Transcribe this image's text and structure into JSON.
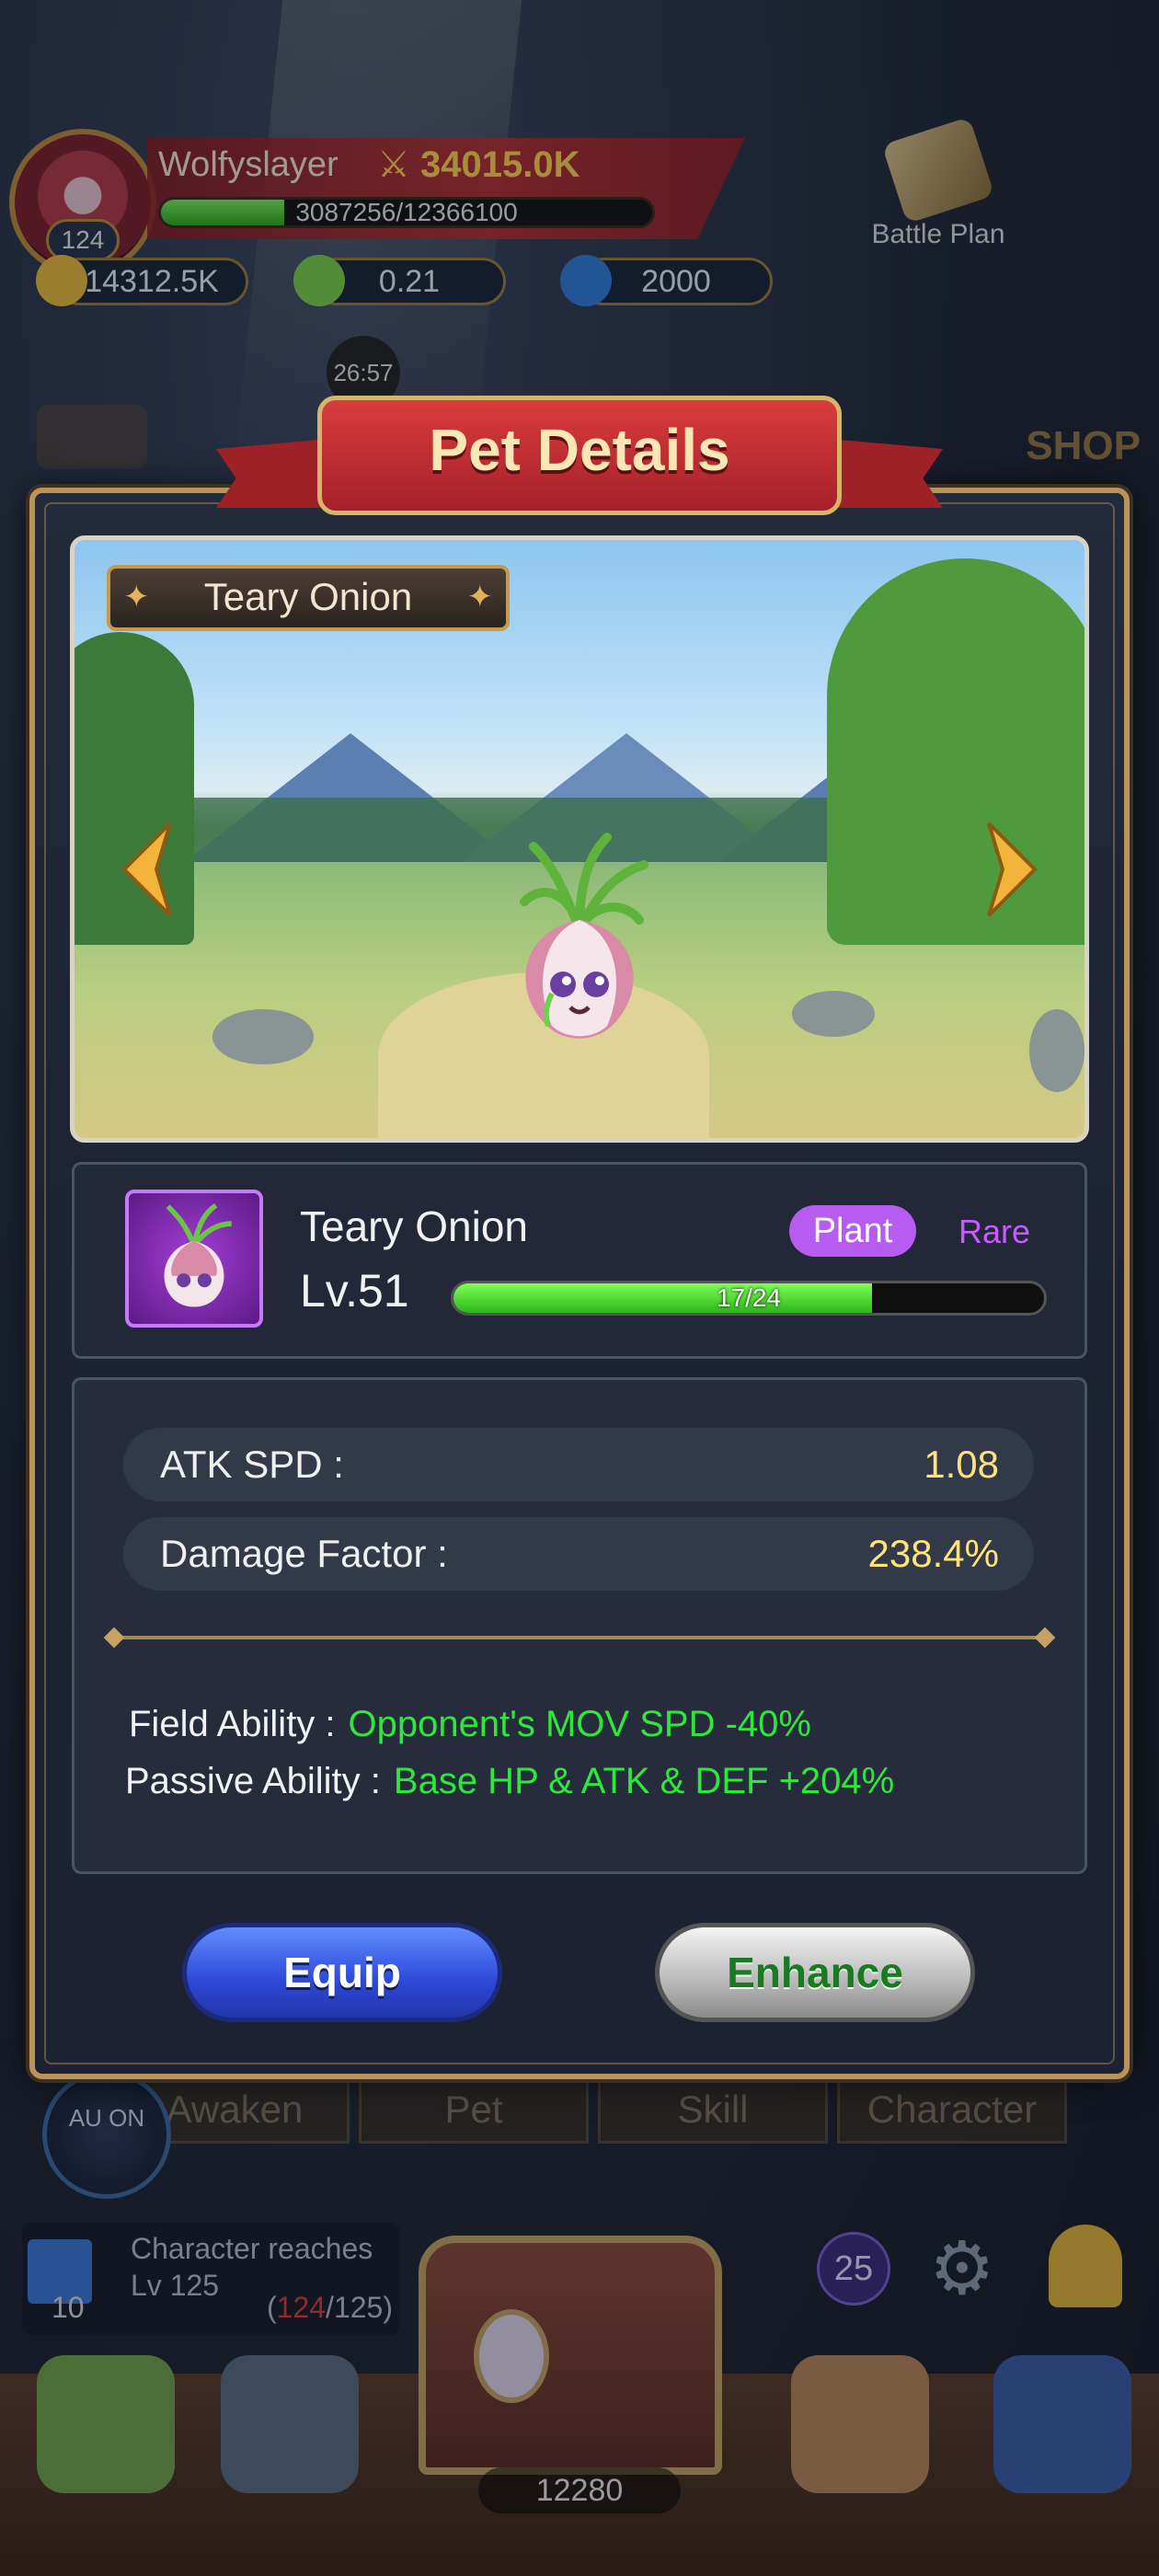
{
  "player": {
    "name": "Wolfyslayer",
    "power": "34015.0K",
    "level": "124",
    "xp_text": "3087256/12366100",
    "xp_fraction": 0.25
  },
  "currencies": [
    {
      "value": "14312.5K",
      "icon": "gold-coin-icon"
    },
    {
      "value": "0.21",
      "icon": "gem-flower-icon"
    },
    {
      "value": "2000",
      "icon": "blue-crystal-icon"
    }
  ],
  "battle_plan_label": "Battle Plan",
  "timer_text": "26:57",
  "shop_label": "SHOP",
  "modal": {
    "title": "Pet Details",
    "pet_plate_name": "Teary Onion",
    "pet": {
      "name": "Teary Onion",
      "level": "Lv.51",
      "type_tag": "Plant",
      "rarity": "Rare",
      "progress_text": "17/24",
      "progress_fraction": 0.708
    },
    "stats": [
      {
        "label": "ATK SPD :",
        "value": "1.08"
      },
      {
        "label": "Damage Factor :",
        "value": "238.4%"
      }
    ],
    "abilities": [
      {
        "label": "Field Ability :",
        "value": "Opponent's MOV SPD -40%"
      },
      {
        "label": "Passive Ability :",
        "value": "Base HP & ATK & DEF +204%"
      }
    ],
    "buttons": {
      "equip": "Equip",
      "enhance": "Enhance"
    }
  },
  "bottom": {
    "auto_label": "AU ON",
    "tabs": [
      "Awaken",
      "Pet",
      "Skill",
      "Character"
    ],
    "quest": {
      "text_line1": "Character reaches",
      "text_line2": "Lv 125",
      "number": "10",
      "progress_current": "124",
      "progress_total": "125"
    },
    "notification_count": "25",
    "gold_count": "12280"
  },
  "colors": {
    "accent_gold": "#b9935a",
    "ability_green": "#2de83b",
    "stat_yellow": "#ffe37a",
    "plant_tag": "#b65cf0",
    "rare_purple": "#c65cff"
  }
}
